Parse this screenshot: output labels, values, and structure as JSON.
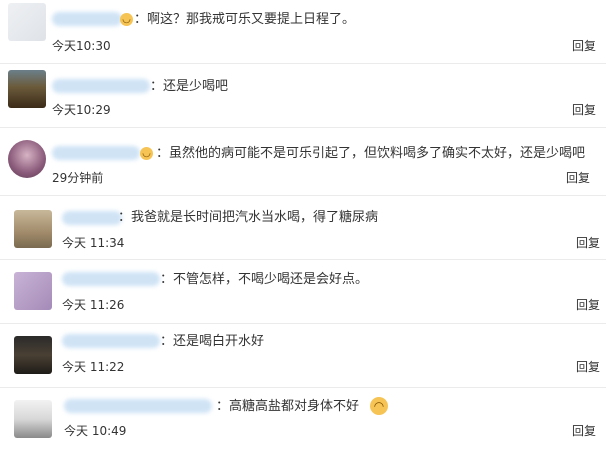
{
  "comments": [
    {
      "text": "：啊这？那我戒可乐又要提上日程了。",
      "time": "今天10:30",
      "reply": "回复",
      "emoji": "smile-emoji"
    },
    {
      "text": "：还是少喝吧",
      "time": "今天10:29",
      "reply": "回复"
    },
    {
      "text": "：虽然他的病可能不是可乐引起了，但饮料喝多了确实不太好，还是少喝吧",
      "time": "29分钟前",
      "reply": "回复",
      "emoji": "smile-emoji"
    },
    {
      "text": "：我爸就是长时间把汽水当水喝，得了糖尿病",
      "time": "今天 11:34",
      "reply": "回复"
    },
    {
      "text": "：不管怎样，不喝少喝还是会好点。",
      "time": "今天 11:26",
      "reply": "回复"
    },
    {
      "text": "：还是喝白开水好",
      "time": "今天 11:22",
      "reply": "回复"
    },
    {
      "text": "：高糖高盐都对身体不好",
      "time": "今天 10:49",
      "reply": "回复",
      "emoji": "laugh-cry-emoji"
    }
  ],
  "colors": {
    "name_blur": "#cfe3f5",
    "divider": "#ebebeb",
    "emoji": "#f6c454"
  }
}
